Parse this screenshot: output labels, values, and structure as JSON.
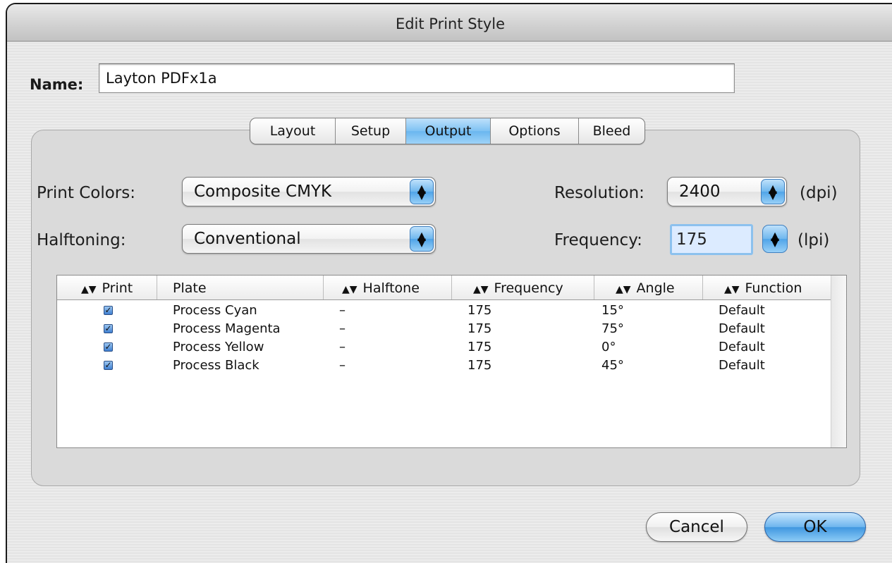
{
  "window": {
    "title": "Edit Print Style"
  },
  "name": {
    "label": "Name:",
    "value": "Layton PDFx1a"
  },
  "tabs": [
    {
      "label": "Layout",
      "active": false
    },
    {
      "label": "Setup",
      "active": false
    },
    {
      "label": "Output",
      "active": true
    },
    {
      "label": "Options",
      "active": false
    },
    {
      "label": "Bleed",
      "active": false
    }
  ],
  "output": {
    "print_colors_label": "Print Colors:",
    "print_colors_value": "Composite CMYK",
    "halftoning_label": "Halftoning:",
    "halftoning_value": "Conventional",
    "resolution_label": "Resolution:",
    "resolution_value": "2400",
    "resolution_unit": "(dpi)",
    "frequency_label": "Frequency:",
    "frequency_value": "175",
    "frequency_unit": "(lpi)"
  },
  "plates_table": {
    "columns": [
      "Print",
      "Plate",
      "Halftone",
      "Frequency",
      "Angle",
      "Function"
    ],
    "rows": [
      {
        "print": true,
        "plate": "Process Cyan",
        "halftone": "–",
        "frequency": "175",
        "angle": "15°",
        "function": "Default"
      },
      {
        "print": true,
        "plate": "Process Magenta",
        "halftone": "–",
        "frequency": "175",
        "angle": "75°",
        "function": "Default"
      },
      {
        "print": true,
        "plate": "Process Yellow",
        "halftone": "–",
        "frequency": "175",
        "angle": "0°",
        "function": "Default"
      },
      {
        "print": true,
        "plate": "Process Black",
        "halftone": "–",
        "frequency": "175",
        "angle": "45°",
        "function": "Default"
      }
    ]
  },
  "buttons": {
    "cancel": "Cancel",
    "ok": "OK"
  },
  "icons": {
    "sort": "sort-arrows-icon",
    "popup": "popup-arrows-icon",
    "stepper": "stepper-arrows-icon",
    "checkbox": "checkmark-icon"
  },
  "colors": {
    "accent": "#6ab6ef",
    "field_focus": "#8cc1ee"
  }
}
